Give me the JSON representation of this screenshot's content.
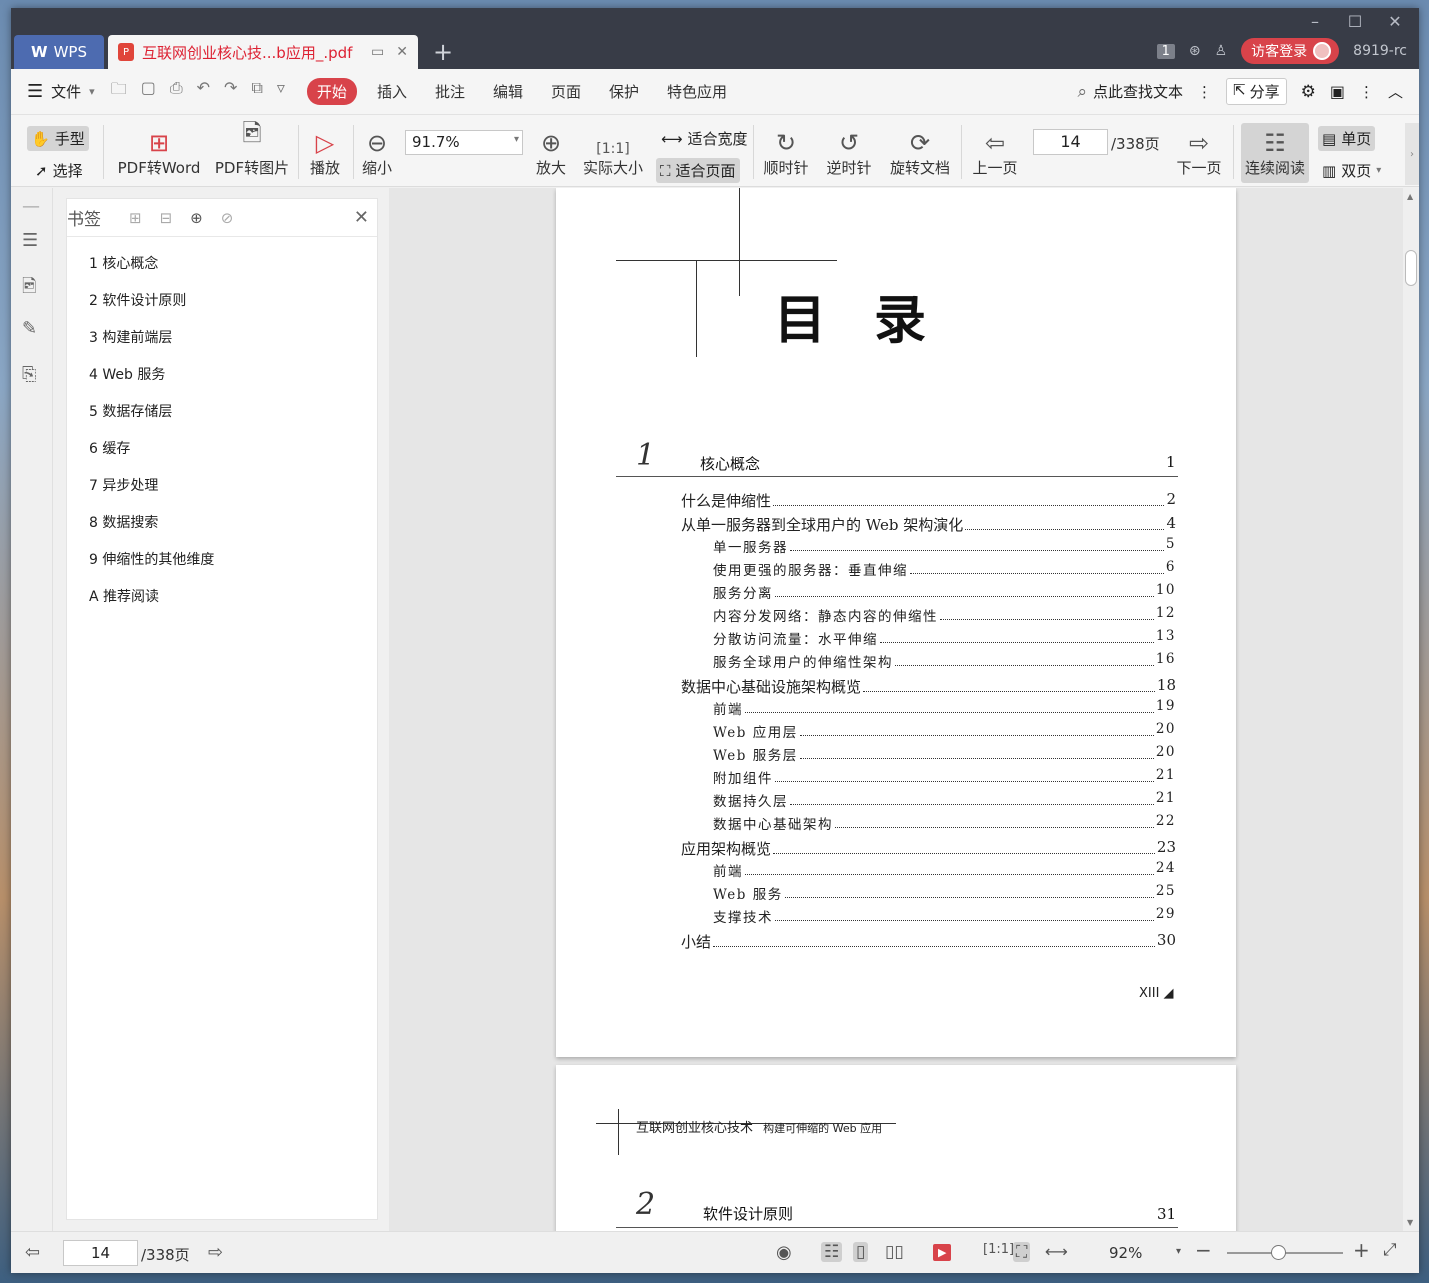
{
  "titlebar": {
    "wps_tab": "WPS",
    "doc_tab": "互联网创业核心技...b应用_.pdf",
    "badge_count": "1",
    "login_label": "访客登录",
    "version": "8919-rc"
  },
  "menubar": {
    "file_label": "文件",
    "tabs": [
      "开始",
      "插入",
      "批注",
      "编辑",
      "页面",
      "保护",
      "特色应用"
    ],
    "search_label": "点此查找文本",
    "share_label": "分享"
  },
  "ribbon": {
    "hand": "手型",
    "select": "选择",
    "pdf_to_word": "PDF转Word",
    "pdf_to_image": "PDF转图片",
    "play": "播放",
    "zoom_out": "缩小",
    "zoom_value": "91.7%",
    "zoom_in": "放大",
    "actual_size": "实际大小",
    "fit_width": "适合宽度",
    "fit_page": "适合页面",
    "clockwise": "顺时针",
    "counter_clockwise": "逆时针",
    "rotate_doc": "旋转文档",
    "prev_page": "上一页",
    "current_page": "14",
    "total_pages": "/338页",
    "next_page": "下一页",
    "continuous": "连续阅读",
    "single": "单页",
    "double": "双页"
  },
  "bookmarks": {
    "title": "书签",
    "items": [
      "1 核心概念",
      "2 软件设计原则",
      "3 构建前端层",
      "4 Web 服务",
      "5 数据存储层",
      "6 缓存",
      "7 异步处理",
      "8 数据搜索",
      "9 伸缩性的其他维度",
      "A 推荐阅读"
    ]
  },
  "document": {
    "toc_title": "目录",
    "chapter1": {
      "num": "1",
      "title": "核心概念",
      "page": "1"
    },
    "entries": [
      {
        "label": "什么是伸缩性",
        "page": "2",
        "level": 1
      },
      {
        "label": "从单一服务器到全球用户的 Web 架构演化",
        "page": "4",
        "level": 1
      },
      {
        "label": "单一服务器",
        "page": "5",
        "level": 2
      },
      {
        "label": "使用更强的服务器：垂直伸缩",
        "page": "6",
        "level": 2
      },
      {
        "label": "服务分离",
        "page": "10",
        "level": 2
      },
      {
        "label": "内容分发网络：静态内容的伸缩性",
        "page": "12",
        "level": 2
      },
      {
        "label": "分散访问流量：水平伸缩",
        "page": "13",
        "level": 2
      },
      {
        "label": "服务全球用户的伸缩性架构",
        "page": "16",
        "level": 2
      },
      {
        "label": "数据中心基础设施架构概览",
        "page": "18",
        "level": 1
      },
      {
        "label": "前端",
        "page": "19",
        "level": 2
      },
      {
        "label": "Web 应用层",
        "page": "20",
        "level": 2
      },
      {
        "label": "Web 服务层",
        "page": "20",
        "level": 2
      },
      {
        "label": "附加组件",
        "page": "21",
        "level": 2
      },
      {
        "label": "数据持久层",
        "page": "21",
        "level": 2
      },
      {
        "label": "数据中心基础架构",
        "page": "22",
        "level": 2
      },
      {
        "label": "应用架构概览",
        "page": "23",
        "level": 1
      },
      {
        "label": "前端",
        "page": "24",
        "level": 2
      },
      {
        "label": "Web 服务",
        "page": "25",
        "level": 2
      },
      {
        "label": "支撑技术",
        "page": "29",
        "level": 2
      },
      {
        "label": "小结",
        "page": "30",
        "level": 1
      }
    ],
    "footer_page": "XIII ◢",
    "running_head": "互联网创业核心技术",
    "running_head_sub": "构建可伸缩的 Web 应用",
    "chapter2": {
      "num": "2",
      "title": "软件设计原则",
      "page": "31"
    }
  },
  "statusbar": {
    "current_page": "14",
    "total_pages": "/338页",
    "zoom": "92%"
  }
}
